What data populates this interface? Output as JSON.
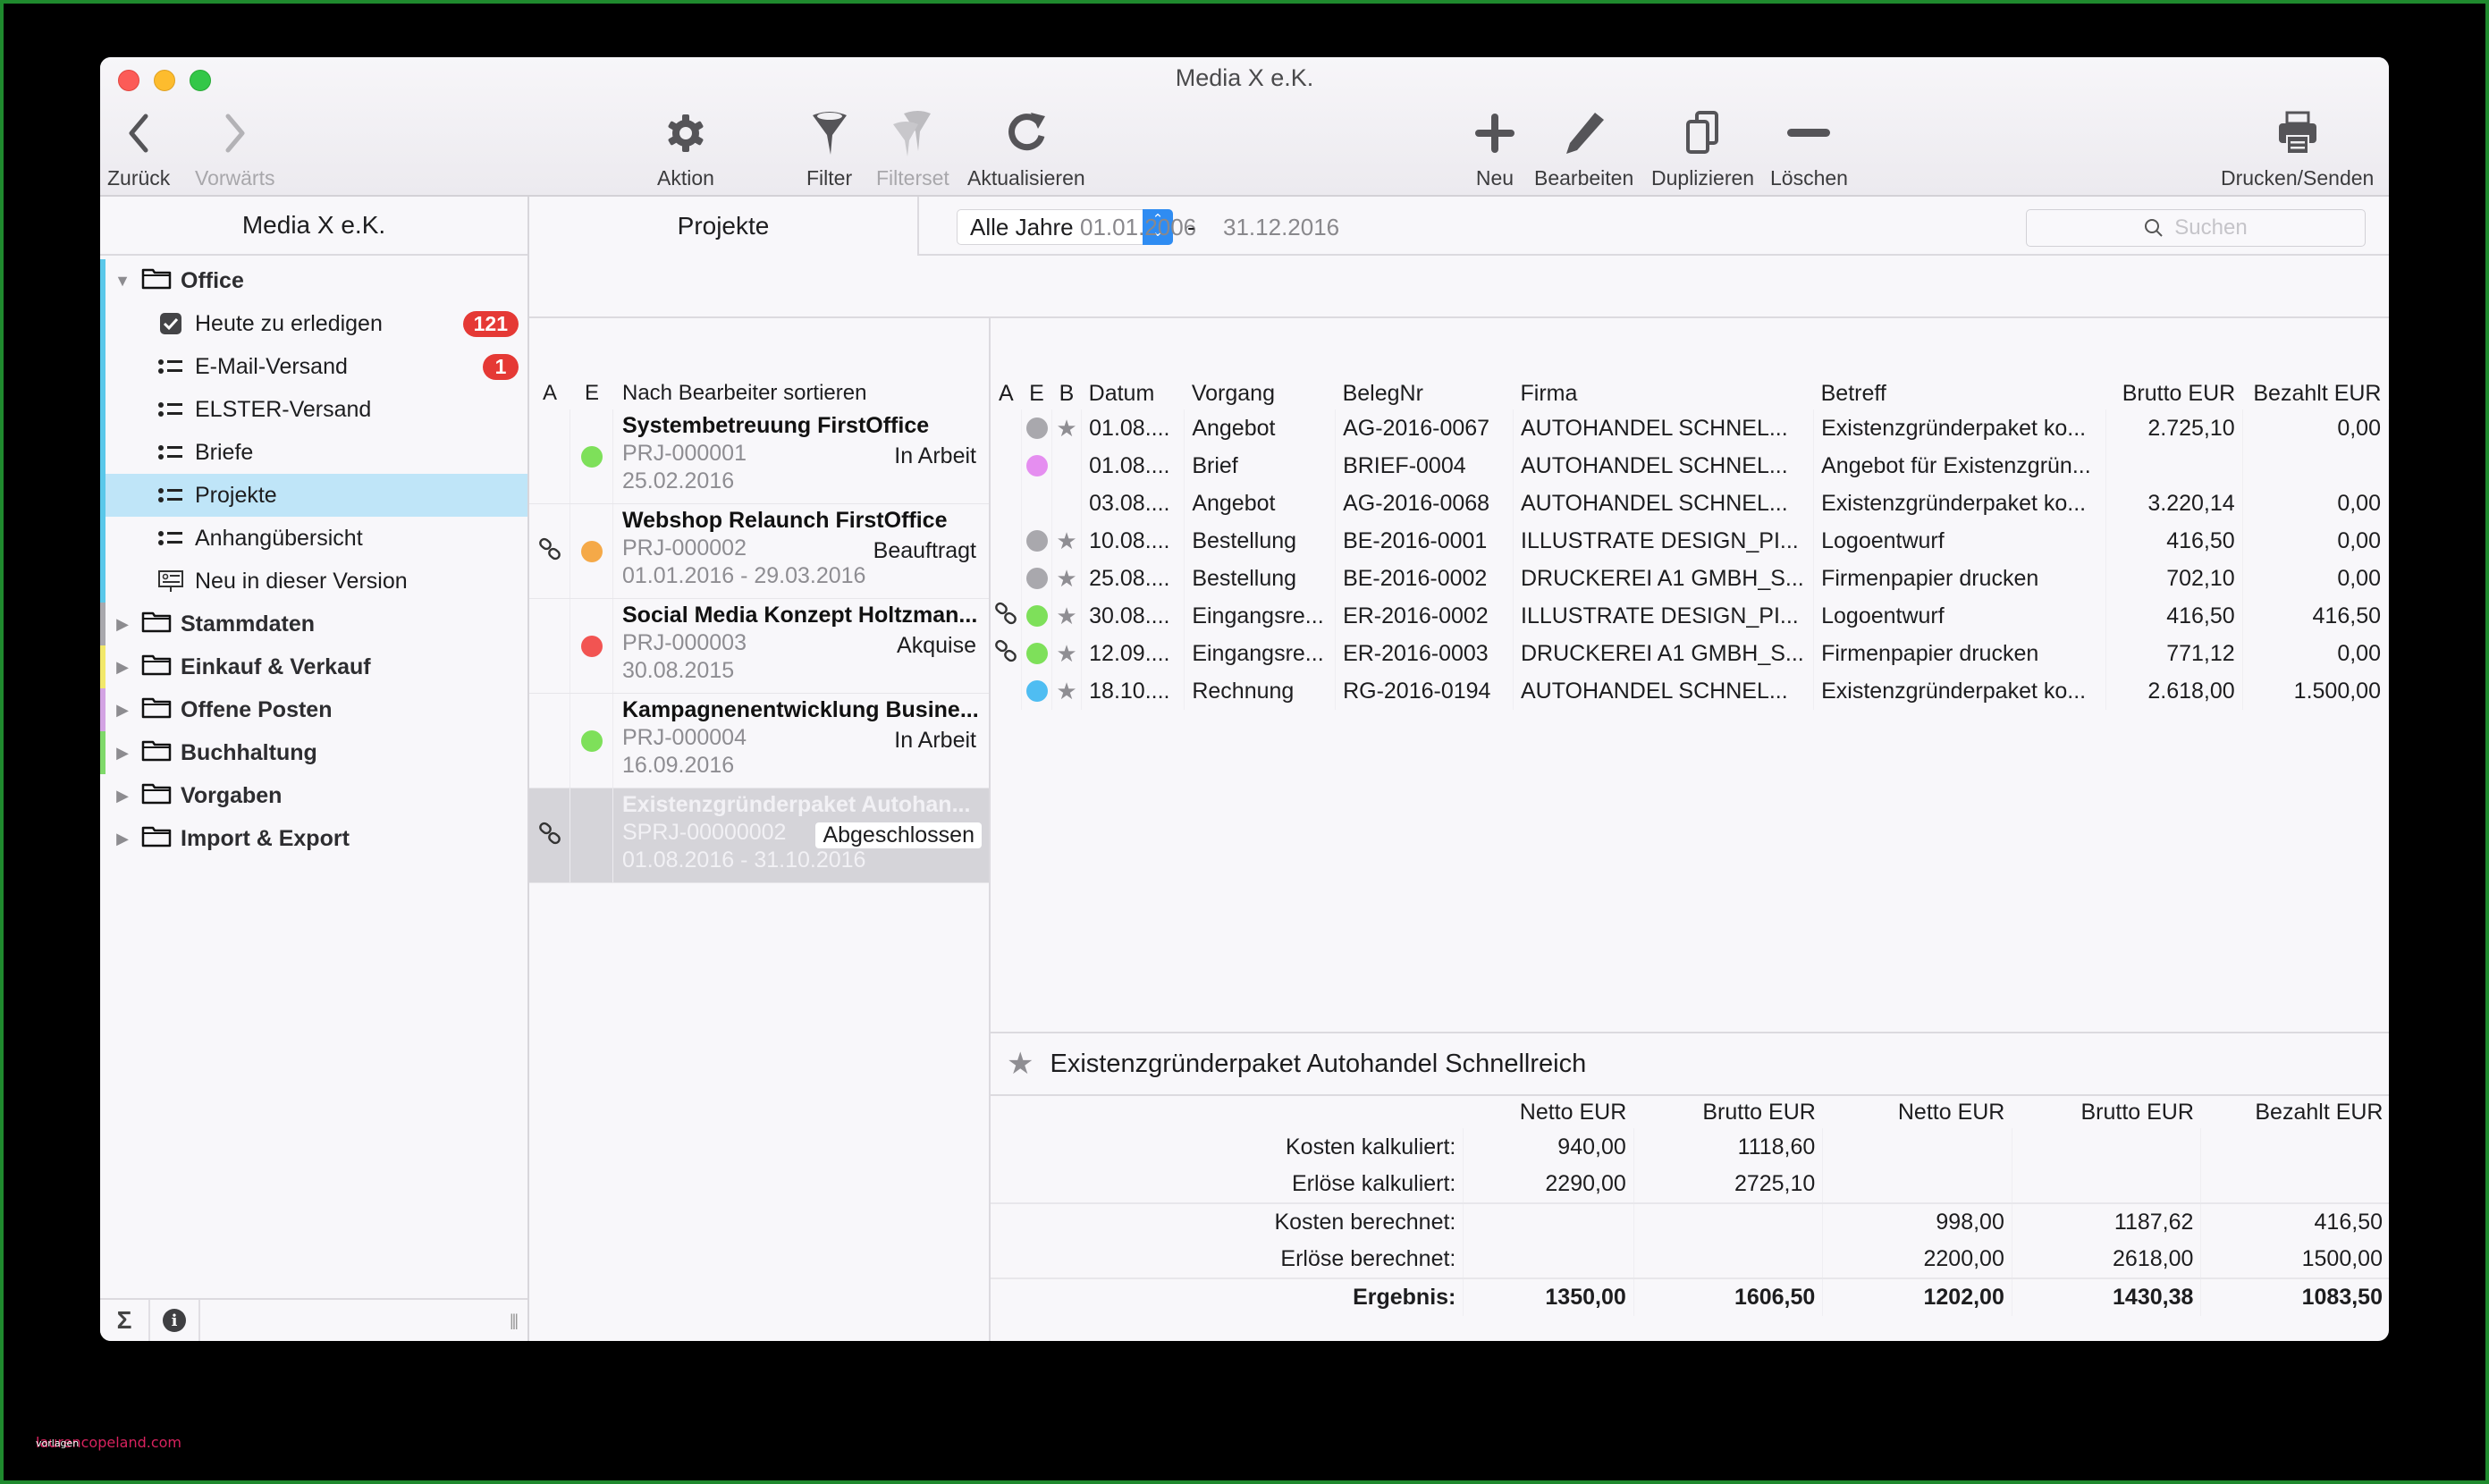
{
  "window": {
    "title": "Media X e.K."
  },
  "toolbar": {
    "back": "Zurück",
    "forward": "Vorwärts",
    "action": "Aktion",
    "filter": "Filter",
    "filterset": "Filterset",
    "refresh": "Aktualisieren",
    "new": "Neu",
    "edit": "Bearbeiten",
    "duplicate": "Duplizieren",
    "delete": "Löschen",
    "print": "Drucken/Senden"
  },
  "sidebar": {
    "title": "Media X e.K.",
    "groups": [
      {
        "label": "Office",
        "expanded": true,
        "color": "#5ac8ea",
        "children": [
          {
            "label": "Heute zu erledigen",
            "icon": "checkbox-icon",
            "badge": "121"
          },
          {
            "label": "E-Mail-Versand",
            "icon": "list-icon",
            "badge": "1"
          },
          {
            "label": "ELSTER-Versand",
            "icon": "list-icon"
          },
          {
            "label": "Briefe",
            "icon": "list-icon"
          },
          {
            "label": "Projekte",
            "icon": "list-icon",
            "selected": true
          },
          {
            "label": "Anhangübersicht",
            "icon": "list-icon"
          },
          {
            "label": "Neu in dieser Version",
            "icon": "presentation-icon"
          }
        ]
      },
      {
        "label": "Stammdaten",
        "color": "#a9a8ad"
      },
      {
        "label": "Einkauf & Verkauf",
        "color": "#f2e86a"
      },
      {
        "label": "Offene Posten",
        "color": "#d3a3e3"
      },
      {
        "label": "Buchhaltung",
        "color": "#7fd96a"
      },
      {
        "label": "Vorgaben",
        "color": ""
      },
      {
        "label": "Import & Export",
        "color": ""
      }
    ],
    "footer": {
      "sum_symbol": "Σ",
      "info_symbol": "i"
    }
  },
  "projects_pane": {
    "title": "Projekte",
    "headers": {
      "a": "A",
      "e": "E",
      "sort": "Nach Bearbeiter sortieren"
    },
    "items": [
      {
        "title": "Systembetreuung FirstOffice",
        "number": "PRJ-000001",
        "status": "In Arbeit",
        "date": "25.02.2016",
        "linked": false,
        "dot": "#7ee05a"
      },
      {
        "title": "Webshop Relaunch FirstOffice",
        "number": "PRJ-000002",
        "status": "Beauftragt",
        "date": "01.01.2016 - 29.03.2016",
        "linked": true,
        "dot": "#f5a948"
      },
      {
        "title": "Social Media Konzept Holtzman...",
        "number": "PRJ-000003",
        "status": "Akquise",
        "date": "30.08.2015",
        "linked": false,
        "dot": "#f25452"
      },
      {
        "title": "Kampagnenentwicklung Busine...",
        "number": "PRJ-000004",
        "status": "In Arbeit",
        "date": "16.09.2016",
        "linked": false,
        "dot": "#7ee05a"
      },
      {
        "title": "Existenzgründerpaket Autohan...",
        "number": "SPRJ-00000002",
        "status": "Abgeschlossen",
        "date": "01.08.2016 - 31.10.2016",
        "linked": true,
        "dot": "",
        "selected": true
      }
    ]
  },
  "filter": {
    "year_select": "Alle Jahre",
    "date_from": "01.01.2006",
    "date_sep": "-",
    "date_to": "31.12.2016",
    "search_placeholder": "Suchen"
  },
  "documents": {
    "headers": [
      "A",
      "E",
      "B",
      "Datum",
      "Vorgang",
      "BelegNr",
      "Firma",
      "Betreff",
      "Brutto EUR",
      "Bezahlt EUR"
    ],
    "rows": [
      {
        "linked": false,
        "dot": "#a9a8ad",
        "starred": true,
        "date": "01.08....",
        "type": "Angebot",
        "number": "AG-2016-0067",
        "company": "AUTOHANDEL SCHNEL...",
        "subject": "Existenzgründerpaket ko...",
        "gross": "2.725,10",
        "paid": "0,00"
      },
      {
        "linked": false,
        "dot": "#e58ef0",
        "starred": false,
        "date": "01.08....",
        "type": "Brief",
        "number": "BRIEF-0004",
        "company": "AUTOHANDEL SCHNEL...",
        "subject": "Angebot für Existenzgrün...",
        "gross": "",
        "paid": ""
      },
      {
        "linked": false,
        "dot": "",
        "starred": false,
        "date": "03.08....",
        "type": "Angebot",
        "number": "AG-2016-0068",
        "company": "AUTOHANDEL SCHNEL...",
        "subject": "Existenzgründerpaket ko...",
        "gross": "3.220,14",
        "paid": "0,00"
      },
      {
        "linked": false,
        "dot": "#a9a8ad",
        "starred": true,
        "date": "10.08....",
        "type": "Bestellung",
        "number": "BE-2016-0001",
        "company": "ILLUSTRATE DESIGN_PI...",
        "subject": "Logoentwurf",
        "gross": "416,50",
        "paid": "0,00"
      },
      {
        "linked": false,
        "dot": "#a9a8ad",
        "starred": true,
        "date": "25.08....",
        "type": "Bestellung",
        "number": "BE-2016-0002",
        "company": "DRUCKEREI A1 GMBH_S...",
        "subject": "Firmenpapier drucken",
        "gross": "702,10",
        "paid": "0,00"
      },
      {
        "linked": true,
        "dot": "#7ee05a",
        "starred": true,
        "date": "30.08....",
        "type": "Eingangsre...",
        "number": "ER-2016-0002",
        "company": "ILLUSTRATE DESIGN_PI...",
        "subject": "Logoentwurf",
        "gross": "416,50",
        "paid": "416,50"
      },
      {
        "linked": true,
        "dot": "#7ee05a",
        "starred": true,
        "date": "12.09....",
        "type": "Eingangsre...",
        "number": "ER-2016-0003",
        "company": "DRUCKEREI A1 GMBH_S...",
        "subject": "Firmenpapier drucken",
        "gross": "771,12",
        "paid": "0,00"
      },
      {
        "linked": false,
        "dot": "#4fbdf2",
        "starred": true,
        "date": "18.10....",
        "type": "Rechnung",
        "number": "RG-2016-0194",
        "company": "AUTOHANDEL SCHNEL...",
        "subject": "Existenzgründerpaket ko...",
        "gross": "2.618,00",
        "paid": "1.500,00"
      }
    ]
  },
  "summary": {
    "title": "Existenzgründerpaket Autohandel Schnellreich",
    "headers": [
      "",
      "Netto EUR",
      "Brutto EUR",
      "Netto EUR",
      "Brutto EUR",
      "Bezahlt EUR"
    ],
    "rows": [
      {
        "label": "Kosten kalkuliert:",
        "values": [
          "940,00",
          "1118,60",
          "",
          "",
          ""
        ]
      },
      {
        "label": "Erlöse kalkuliert:",
        "values": [
          "2290,00",
          "2725,10",
          "",
          "",
          ""
        ]
      },
      {
        "label": "Kosten berechnet:",
        "values": [
          "",
          "",
          "998,00",
          "1187,62",
          "416,50"
        ],
        "sep": true
      },
      {
        "label": "Erlöse berechnet:",
        "values": [
          "",
          "",
          "2200,00",
          "2618,00",
          "1500,00"
        ]
      },
      {
        "label": "Ergebnis:",
        "values": [
          "1350,00",
          "1606,50",
          "1202,00",
          "1430,38",
          "1083,50"
        ],
        "sep": true,
        "total": true
      }
    ]
  },
  "watermark": {
    "text": "laurencopeland.com",
    "subtext": "vorlagen"
  }
}
